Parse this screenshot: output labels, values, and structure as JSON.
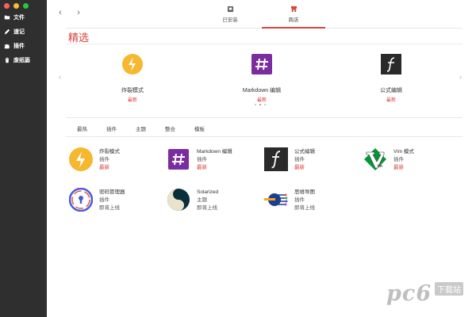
{
  "sidebar": {
    "items": [
      {
        "label": "文件",
        "icon": "folder-icon"
      },
      {
        "label": "速记",
        "icon": "pencil-icon"
      },
      {
        "label": "插件",
        "icon": "puzzle-icon"
      },
      {
        "label": "废纸篓",
        "icon": "trash-icon"
      }
    ]
  },
  "nav": {
    "back": "‹",
    "forward": "›"
  },
  "tabs": [
    {
      "label": "已安装",
      "icon": "installed-box-icon"
    },
    {
      "label": "商店",
      "icon": "store-icon",
      "active": true
    }
  ],
  "section": {
    "title": "精选"
  },
  "featured": [
    {
      "name": "炸裂模式",
      "status": "最新",
      "icon": "lightning-icon"
    },
    {
      "name": "Markdown 编辑",
      "status": "最新",
      "icon": "hash-icon"
    },
    {
      "name": "公式编辑",
      "status": "最新",
      "icon": "formula-icon"
    }
  ],
  "carousel": {
    "prev": "‹",
    "next": "›",
    "pages": 3,
    "current": 1
  },
  "filters": [
    "最热",
    "插件",
    "主题",
    "整合",
    "模板"
  ],
  "plugins": [
    {
      "name": "炸裂模式",
      "type": "插件",
      "status": "最新",
      "icon": "lightning-icon"
    },
    {
      "name": "Markdown 编辑",
      "type": "插件",
      "status": "最新",
      "icon": "hash-icon"
    },
    {
      "name": "公式编辑",
      "type": "插件",
      "status": "最新",
      "icon": "formula-icon"
    },
    {
      "name": "Vim 模式",
      "type": "插件",
      "status": "最新",
      "icon": "vim-icon"
    },
    {
      "name": "密码管理器",
      "type": "插件",
      "status": "即将上线",
      "icon": "keyhole-icon"
    },
    {
      "name": "Solarized",
      "type": "主题",
      "status": "即将上线",
      "icon": "yin-yang-icon"
    },
    {
      "name": "思维导图",
      "type": "插件",
      "status": "即将上线",
      "icon": "mindmap-icon"
    }
  ],
  "watermark": {
    "text": "pc6",
    "sub": "下载站"
  },
  "colors": {
    "accent": "#d9423a",
    "sidebar": "#2f2f30"
  }
}
